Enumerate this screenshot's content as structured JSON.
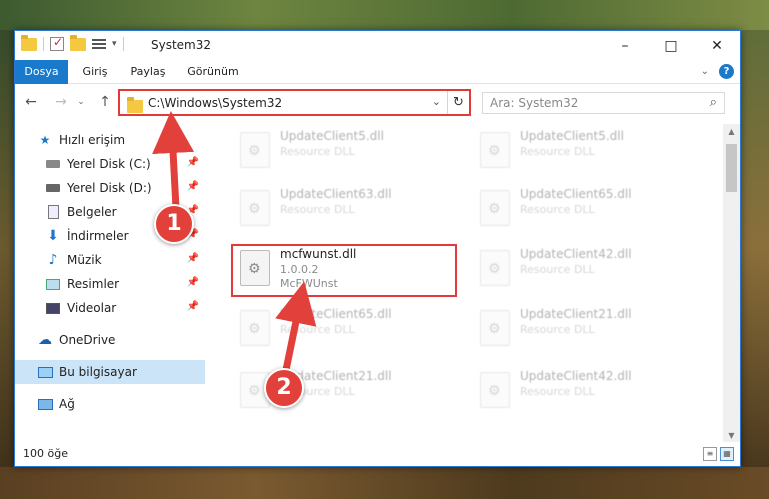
{
  "window": {
    "title": "System32"
  },
  "ribbon": {
    "tabs": [
      "Dosya",
      "Giriş",
      "Paylaş",
      "Görünüm"
    ]
  },
  "address": {
    "path": "C:\\Windows\\System32",
    "search_placeholder": "Ara: System32"
  },
  "sidebar": {
    "items": [
      {
        "label": "Hızlı erişim",
        "icon": "star-icon"
      },
      {
        "label": "Yerel Disk (C:)",
        "icon": "drive-icon"
      },
      {
        "label": "Yerel Disk (D:)",
        "icon": "drive-icon"
      },
      {
        "label": "Belgeler",
        "icon": "documents-icon"
      },
      {
        "label": "İndirmeler",
        "icon": "download-icon"
      },
      {
        "label": "Müzik",
        "icon": "music-icon"
      },
      {
        "label": "Resimler",
        "icon": "pictures-icon"
      },
      {
        "label": "Videolar",
        "icon": "videos-icon"
      },
      {
        "label": "OneDrive",
        "icon": "cloud-icon"
      },
      {
        "label": "Bu bilgisayar",
        "icon": "computer-icon"
      },
      {
        "label": "Ağ",
        "icon": "network-icon"
      }
    ]
  },
  "files": [
    {
      "name": "UpdateClient5.dll",
      "sub1": "Resource DLL",
      "sub2": ""
    },
    {
      "name": "UpdateClient5.dll",
      "sub1": "Resource DLL",
      "sub2": ""
    },
    {
      "name": "UpdateClient63.dll",
      "sub1": "Resource DLL",
      "sub2": ""
    },
    {
      "name": "UpdateClient65.dll",
      "sub1": "Resource DLL",
      "sub2": ""
    },
    {
      "name": "mcfwunst.dll",
      "sub1": "1.0.0.2",
      "sub2": "McFWUnst"
    },
    {
      "name": "UpdateClient42.dll",
      "sub1": "Resource DLL",
      "sub2": ""
    },
    {
      "name": "UpdateClient65.dll",
      "sub1": "Resource DLL",
      "sub2": ""
    },
    {
      "name": "UpdateClient21.dll",
      "sub1": "Resource DLL",
      "sub2": ""
    },
    {
      "name": "UpdateClient21.dll",
      "sub1": "Resource DLL",
      "sub2": ""
    },
    {
      "name": "UpdateClient42.dll",
      "sub1": "Resource DLL",
      "sub2": ""
    }
  ],
  "status": {
    "item_count": "100 öğe"
  },
  "annotations": {
    "step1": "1",
    "step2": "2",
    "color": "#e2403a"
  }
}
